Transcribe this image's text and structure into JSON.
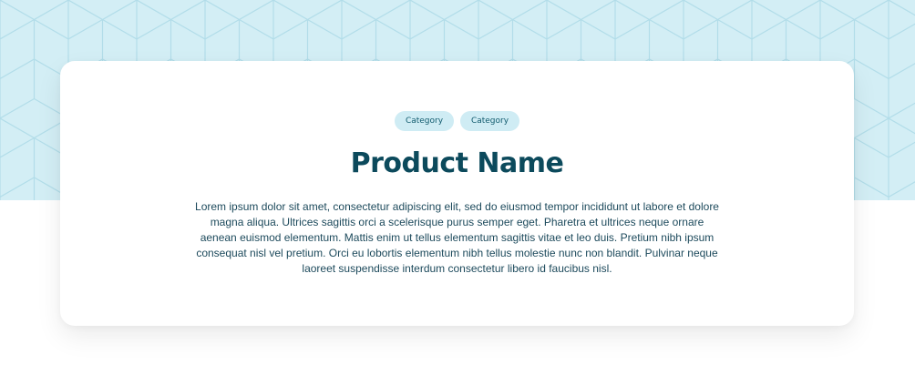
{
  "product": {
    "categories": [
      "Category",
      "Category"
    ],
    "name": "Product Name",
    "description": "Lorem ipsum dolor sit amet, consectetur adipiscing elit, sed do eiusmod tempor incididunt ut labore et dolore magna aliqua. Ultrices sagittis orci a scelerisque purus semper eget. Pharetra et ultrices neque ornare aenean euismod elementum. Mattis enim ut tellus elementum sagittis vitae et leo duis. Pretium nibh ipsum consequat nisl vel pretium. Orci eu lobortis elementum nibh tellus molestie nunc non blandit. Pulvinar neque laoreet suspendisse interdum consectetur libero id faucibus nisl."
  },
  "colors": {
    "hero_background": "#d3eef5",
    "hero_pattern_line": "#b2dde9",
    "badge_background": "#cfecf4",
    "badge_text": "#115b6e",
    "title_text": "#0c4a5c",
    "body_text": "#1d4a5c"
  }
}
